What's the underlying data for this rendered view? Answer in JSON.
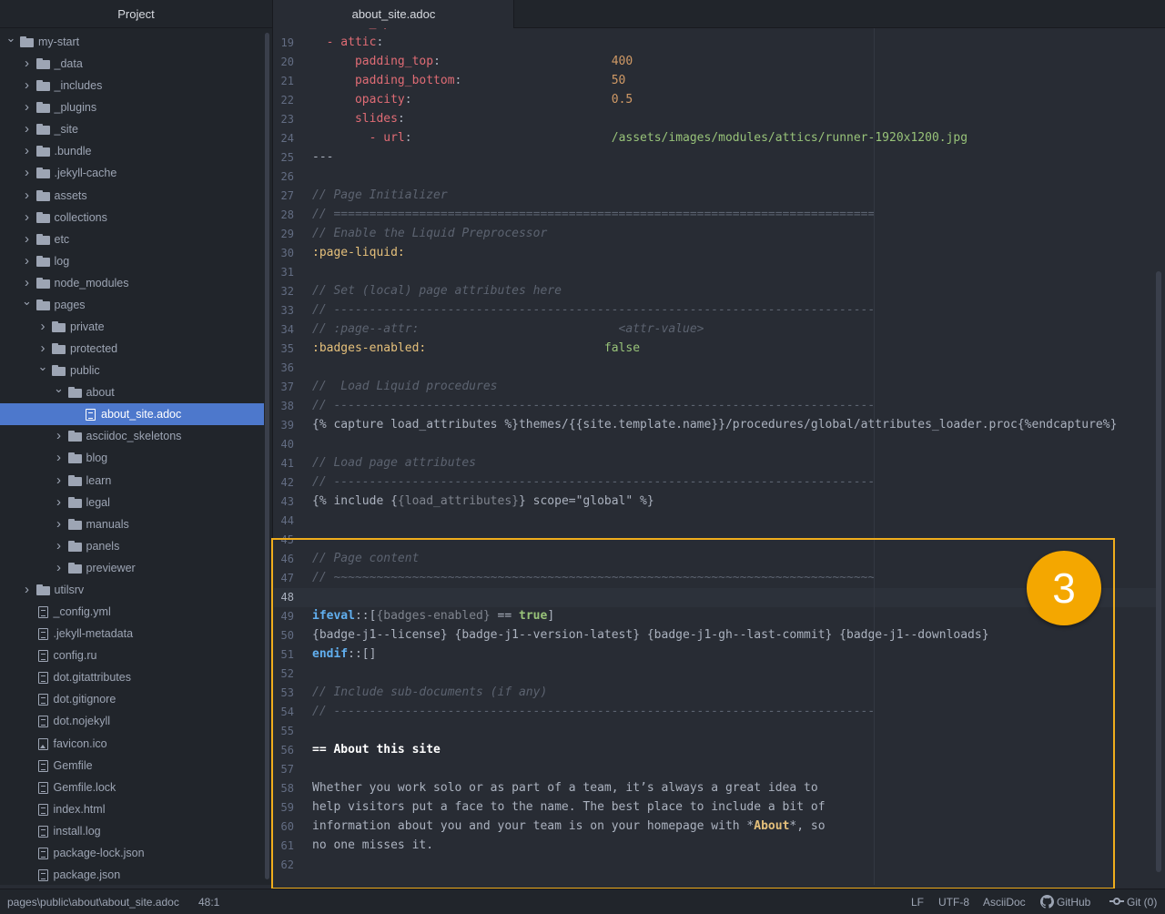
{
  "sidebar": {
    "title": "Project",
    "tree": [
      {
        "label": "my-start",
        "type": "folder",
        "depth": 0,
        "expanded": true
      },
      {
        "label": "_data",
        "type": "folder",
        "depth": 1,
        "expanded": false
      },
      {
        "label": "_includes",
        "type": "folder",
        "depth": 1,
        "expanded": false
      },
      {
        "label": "_plugins",
        "type": "folder",
        "depth": 1,
        "expanded": false
      },
      {
        "label": "_site",
        "type": "folder",
        "depth": 1,
        "expanded": false
      },
      {
        "label": ".bundle",
        "type": "folder",
        "depth": 1,
        "expanded": false
      },
      {
        "label": ".jekyll-cache",
        "type": "folder",
        "depth": 1,
        "expanded": false
      },
      {
        "label": "assets",
        "type": "folder",
        "depth": 1,
        "expanded": false
      },
      {
        "label": "collections",
        "type": "folder",
        "depth": 1,
        "expanded": false
      },
      {
        "label": "etc",
        "type": "folder",
        "depth": 1,
        "expanded": false
      },
      {
        "label": "log",
        "type": "folder",
        "depth": 1,
        "expanded": false
      },
      {
        "label": "node_modules",
        "type": "folder",
        "depth": 1,
        "expanded": false
      },
      {
        "label": "pages",
        "type": "folder",
        "depth": 1,
        "expanded": true
      },
      {
        "label": "private",
        "type": "folder",
        "depth": 2,
        "expanded": false
      },
      {
        "label": "protected",
        "type": "folder",
        "depth": 2,
        "expanded": false
      },
      {
        "label": "public",
        "type": "folder",
        "depth": 2,
        "expanded": true
      },
      {
        "label": "about",
        "type": "folder",
        "depth": 3,
        "expanded": true
      },
      {
        "label": "about_site.adoc",
        "type": "file",
        "depth": 4,
        "selected": true
      },
      {
        "label": "asciidoc_skeletons",
        "type": "folder",
        "depth": 3,
        "expanded": false
      },
      {
        "label": "blog",
        "type": "folder",
        "depth": 3,
        "expanded": false
      },
      {
        "label": "learn",
        "type": "folder",
        "depth": 3,
        "expanded": false
      },
      {
        "label": "legal",
        "type": "folder",
        "depth": 3,
        "expanded": false
      },
      {
        "label": "manuals",
        "type": "folder",
        "depth": 3,
        "expanded": false
      },
      {
        "label": "panels",
        "type": "folder",
        "depth": 3,
        "expanded": false
      },
      {
        "label": "previewer",
        "type": "folder",
        "depth": 3,
        "expanded": false
      },
      {
        "label": "utilsrv",
        "type": "folder",
        "depth": 1,
        "expanded": false
      },
      {
        "label": "_config.yml",
        "type": "file",
        "depth": 1
      },
      {
        "label": ".jekyll-metadata",
        "type": "file",
        "depth": 1
      },
      {
        "label": "config.ru",
        "type": "file",
        "depth": 1
      },
      {
        "label": "dot.gitattributes",
        "type": "file",
        "depth": 1
      },
      {
        "label": "dot.gitignore",
        "type": "file",
        "depth": 1
      },
      {
        "label": "dot.nojekyll",
        "type": "file",
        "depth": 1
      },
      {
        "label": "favicon.ico",
        "type": "image",
        "depth": 1
      },
      {
        "label": "Gemfile",
        "type": "file",
        "depth": 1
      },
      {
        "label": "Gemfile.lock",
        "type": "file",
        "depth": 1
      },
      {
        "label": "index.html",
        "type": "file",
        "depth": 1
      },
      {
        "label": "install.log",
        "type": "file",
        "depth": 1
      },
      {
        "label": "package-lock.json",
        "type": "file",
        "depth": 1
      },
      {
        "label": "package.json",
        "type": "file",
        "depth": 1
      }
    ]
  },
  "editor": {
    "tab_title": "about_site.adoc",
    "cursor_line": 48,
    "lines": [
      {
        "n": "18",
        "tokens": [
          [
            "t-key",
            "resource_options:"
          ]
        ]
      },
      {
        "n": "19",
        "tokens": [
          [
            "",
            "  "
          ],
          [
            "t-key",
            "- attic"
          ],
          [
            "",
            ":"
          ]
        ]
      },
      {
        "n": "20",
        "tokens": [
          [
            "",
            "      "
          ],
          [
            "t-key",
            "padding_top"
          ],
          [
            "",
            ":                        "
          ],
          [
            "t-val",
            "400"
          ]
        ]
      },
      {
        "n": "21",
        "tokens": [
          [
            "",
            "      "
          ],
          [
            "t-key",
            "padding_bottom"
          ],
          [
            "",
            ":                     "
          ],
          [
            "t-val",
            "50"
          ]
        ]
      },
      {
        "n": "22",
        "tokens": [
          [
            "",
            "      "
          ],
          [
            "t-key",
            "opacity"
          ],
          [
            "",
            ":                            "
          ],
          [
            "t-val",
            "0.5"
          ]
        ]
      },
      {
        "n": "23",
        "tokens": [
          [
            "",
            "      "
          ],
          [
            "t-key",
            "slides"
          ],
          [
            "",
            ":"
          ]
        ]
      },
      {
        "n": "24",
        "tokens": [
          [
            "",
            "        "
          ],
          [
            "t-key",
            "- url"
          ],
          [
            "",
            ":                            "
          ],
          [
            "t-str",
            "/assets/images/modules/attics/runner-1920x1200.jpg"
          ]
        ]
      },
      {
        "n": "25",
        "tokens": [
          [
            "",
            "---"
          ]
        ]
      },
      {
        "n": "26",
        "tokens": []
      },
      {
        "n": "27",
        "tokens": [
          [
            "t-com",
            "// Page Initializer"
          ]
        ]
      },
      {
        "n": "28",
        "tokens": [
          [
            "t-com",
            "// ============================================================================"
          ]
        ]
      },
      {
        "n": "29",
        "tokens": [
          [
            "t-com",
            "// Enable the Liquid Preprocessor"
          ]
        ]
      },
      {
        "n": "30",
        "tokens": [
          [
            "t-attr",
            ":page-liquid:"
          ]
        ]
      },
      {
        "n": "31",
        "tokens": []
      },
      {
        "n": "32",
        "tokens": [
          [
            "t-com",
            "// Set (local) page attributes here"
          ]
        ]
      },
      {
        "n": "33",
        "tokens": [
          [
            "t-com",
            "// ----------------------------------------------------------------------------"
          ]
        ]
      },
      {
        "n": "34",
        "tokens": [
          [
            "t-com",
            "// :page--attr:                            <attr-value>"
          ]
        ]
      },
      {
        "n": "35",
        "tokens": [
          [
            "t-attr",
            ":badges-enabled:"
          ],
          [
            "",
            "                         "
          ],
          [
            "t-str",
            "false"
          ]
        ]
      },
      {
        "n": "36",
        "tokens": []
      },
      {
        "n": "37",
        "tokens": [
          [
            "t-com",
            "//  Load Liquid procedures"
          ]
        ]
      },
      {
        "n": "38",
        "tokens": [
          [
            "t-com",
            "// ----------------------------------------------------------------------------"
          ]
        ]
      },
      {
        "n": "39",
        "tokens": [
          [
            "",
            "{% capture load_attributes %}themes/{{site.template.name}}/procedures/global/attributes_loader.proc{%endcapture%}"
          ]
        ]
      },
      {
        "n": "40",
        "tokens": []
      },
      {
        "n": "41",
        "tokens": [
          [
            "t-com",
            "// Load page attributes"
          ]
        ]
      },
      {
        "n": "42",
        "tokens": [
          [
            "t-com",
            "// ----------------------------------------------------------------------------"
          ]
        ]
      },
      {
        "n": "43",
        "tokens": [
          [
            "",
            "{% include {"
          ],
          [
            "t-dim",
            "{load_attributes}"
          ],
          [
            "",
            "} scope=\"global\" %}"
          ]
        ]
      },
      {
        "n": "44",
        "tokens": []
      },
      {
        "n": "45",
        "tokens": []
      },
      {
        "n": "46",
        "tokens": [
          [
            "t-com",
            "// Page content"
          ]
        ]
      },
      {
        "n": "47",
        "tokens": [
          [
            "t-com",
            "// ~~~~~~~~~~~~~~~~~~~~~~~~~~~~~~~~~~~~~~~~~~~~~~~~~~~~~~~~~~~~~~~~~~~~~~~~~~~~"
          ]
        ]
      },
      {
        "n": "48",
        "tokens": []
      },
      {
        "n": "49",
        "tokens": [
          [
            "t-kw",
            "ifeval"
          ],
          [
            "",
            "::["
          ],
          [
            "t-dim",
            "{badges-enabled}"
          ],
          [
            "",
            " == "
          ],
          [
            "t-bool",
            "true"
          ],
          [
            "",
            "]"
          ]
        ]
      },
      {
        "n": "50",
        "tokens": [
          [
            "",
            "{badge-j1--license} {badge-j1--version-latest} {badge-j1-gh--last-commit} {badge-j1--downloads}"
          ]
        ]
      },
      {
        "n": "51",
        "tokens": [
          [
            "t-kw",
            "endif"
          ],
          [
            "",
            "::[]"
          ]
        ]
      },
      {
        "n": "52",
        "tokens": []
      },
      {
        "n": "53",
        "tokens": [
          [
            "t-com",
            "// Include sub-documents (if any)"
          ]
        ]
      },
      {
        "n": "54",
        "tokens": [
          [
            "t-com",
            "// ----------------------------------------------------------------------------"
          ]
        ]
      },
      {
        "n": "55",
        "tokens": []
      },
      {
        "n": "56",
        "tokens": [
          [
            "t-head",
            "== About this site"
          ]
        ]
      },
      {
        "n": "57",
        "tokens": []
      },
      {
        "n": "58",
        "tokens": [
          [
            "",
            "Whether you work solo or as part of a team, it’s always a great idea to"
          ]
        ]
      },
      {
        "n": "59",
        "tokens": [
          [
            "",
            "help visitors put a face to the name. The best place to include a bit of"
          ]
        ]
      },
      {
        "n": "60",
        "tokens": [
          [
            "",
            "information about you and your team is on your homepage with *"
          ],
          [
            "t-bold",
            "About"
          ],
          [
            "",
            "*, so"
          ]
        ]
      },
      {
        "n": "61",
        "tokens": [
          [
            "",
            "no one misses it."
          ]
        ]
      },
      {
        "n": "62",
        "tokens": []
      }
    ]
  },
  "callout": {
    "number": "3",
    "color": "#f4a700"
  },
  "statusbar": {
    "file_path": "pages\\public\\about\\about_site.adoc",
    "cursor_pos": "48:1",
    "line_ending": "LF",
    "encoding": "UTF-8",
    "grammar": "AsciiDoc",
    "github_label": "GitHub",
    "github_icon": "github-icon",
    "git_label": "Git (0)",
    "git_icon": "git-commit-icon"
  },
  "colors": {
    "accent_selection": "#4d78cc",
    "callout": "#f0ad1c"
  }
}
